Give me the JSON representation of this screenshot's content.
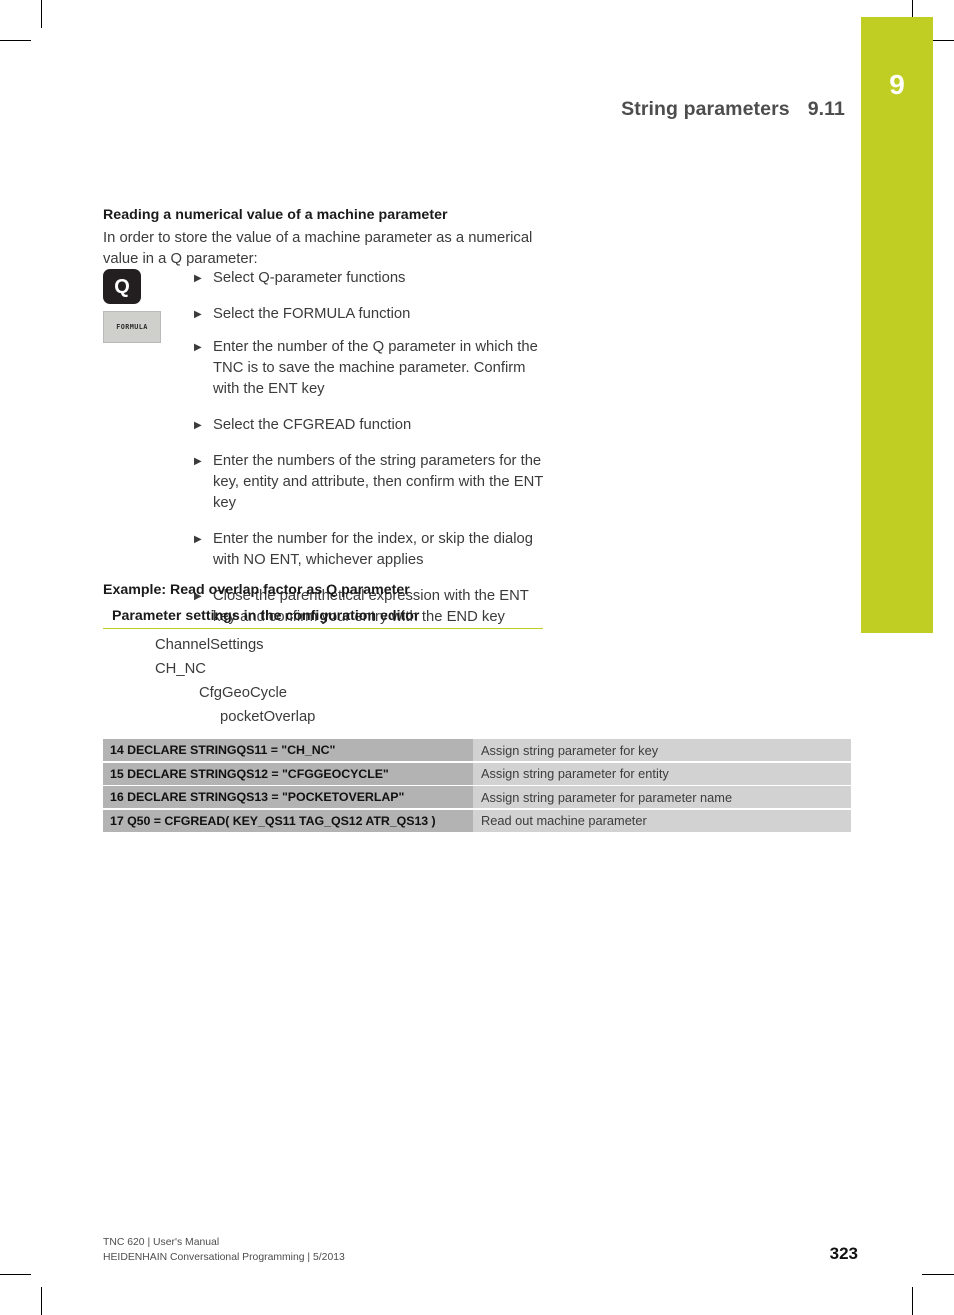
{
  "chapter_tab": {
    "number": "9",
    "color": "#c0cd23"
  },
  "running_head": {
    "title": "String parameters",
    "section": "9.11"
  },
  "body": {
    "subheading": "Reading a numerical value of a machine parameter",
    "intro": "In order to store the value of a machine parameter as a numerical value in a Q parameter:",
    "keys": {
      "q_key_label": "Q",
      "formula_key_label": "FORMULA"
    },
    "steps": [
      {
        "bullet": "▶",
        "text": "Select Q-parameter functions"
      },
      {
        "bullet": "▶",
        "text": "Select the FORMULA function"
      },
      {
        "bullet": "▶",
        "text": "Enter the number of the Q parameter in which the TNC is to save the machine parameter. Confirm with the ENT key"
      },
      {
        "bullet": "▶",
        "text": "Select the CFGREAD function"
      },
      {
        "bullet": "▶",
        "text": "Enter the numbers of the string parameters for the key, entity and attribute, then confirm with the ENT key"
      },
      {
        "bullet": "▶",
        "text": "Enter the number for the index, or skip the dialog with NO ENT, whichever applies"
      },
      {
        "bullet": "▶",
        "text": "Close the parenthetical expression with the ENT key and confirm your entry with the END key"
      }
    ]
  },
  "example": {
    "title": "Example: Read overlap factor as Q parameter",
    "config_title": "Parameter settings in the configuration editor",
    "rule_color": "#c0cd23",
    "tree": [
      {
        "level": 0,
        "label": "ChannelSettings"
      },
      {
        "level": 0,
        "label": "CH_NC"
      },
      {
        "level": 1,
        "label": "CfgGeoCycle"
      },
      {
        "level": 2,
        "label": "pocketOverlap"
      }
    ]
  },
  "nc_table": {
    "code_bg": "#b3b3b3",
    "desc_bg": "#d2d2d2",
    "rows": [
      {
        "code": "14 DECLARE STRINGQS11 = \"CH_NC\"",
        "desc": "Assign string parameter for key"
      },
      {
        "code": "15 DECLARE STRINGQS12 = \"CFGGEOCYCLE\"",
        "desc": "Assign string parameter for entity"
      },
      {
        "code": "16 DECLARE STRINGQS13 = \"POCKETOVERLAP\"",
        "desc": "Assign string parameter for parameter name"
      },
      {
        "code": "17 Q50 = CFGREAD( KEY_QS11 TAG_QS12 ATR_QS13 )",
        "desc": "Read out machine parameter"
      }
    ]
  },
  "footer": {
    "line1": "TNC 620 | User's Manual",
    "line2": "HEIDENHAIN Conversational Programming | 5/2013",
    "page_number": "323"
  }
}
